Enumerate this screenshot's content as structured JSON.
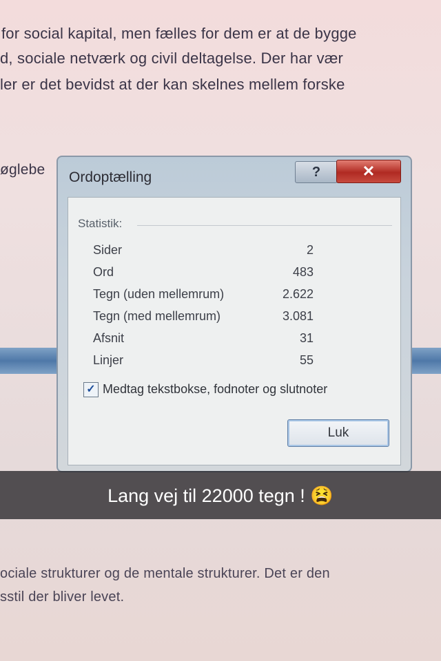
{
  "document": {
    "line1": "for social kapital, men fælles for dem er at de bygge",
    "line2": "d, sociale netværk og civil deltagelse. Der har vær",
    "line3": "ler er det bevidst at der kan skelnes mellem forske",
    "line4": "øglebe",
    "line5": "ociale strukturer og de mentale strukturer.  Det er den",
    "line6": "sstil der bliver levet."
  },
  "dialog": {
    "title": "Ordoptælling",
    "help_label": "?",
    "close_label": "✕",
    "section_label": "Statistik:",
    "stats": [
      {
        "label": "Sider",
        "value": "2"
      },
      {
        "label": "Ord",
        "value": "483"
      },
      {
        "label": "Tegn (uden mellemrum)",
        "value": "2.622"
      },
      {
        "label": "Tegn (med mellemrum)",
        "value": "3.081"
      },
      {
        "label": "Afsnit",
        "value": "31"
      },
      {
        "label": "Linjer",
        "value": "55"
      }
    ],
    "checkbox_checked": true,
    "checkbox_mark": "✓",
    "checkbox_label": "Medtag tekstbokse, fodnoter og slutnoter",
    "close_button": "Luk"
  },
  "caption": {
    "text": "Lang vej til 22000 tegn ! 😫"
  }
}
